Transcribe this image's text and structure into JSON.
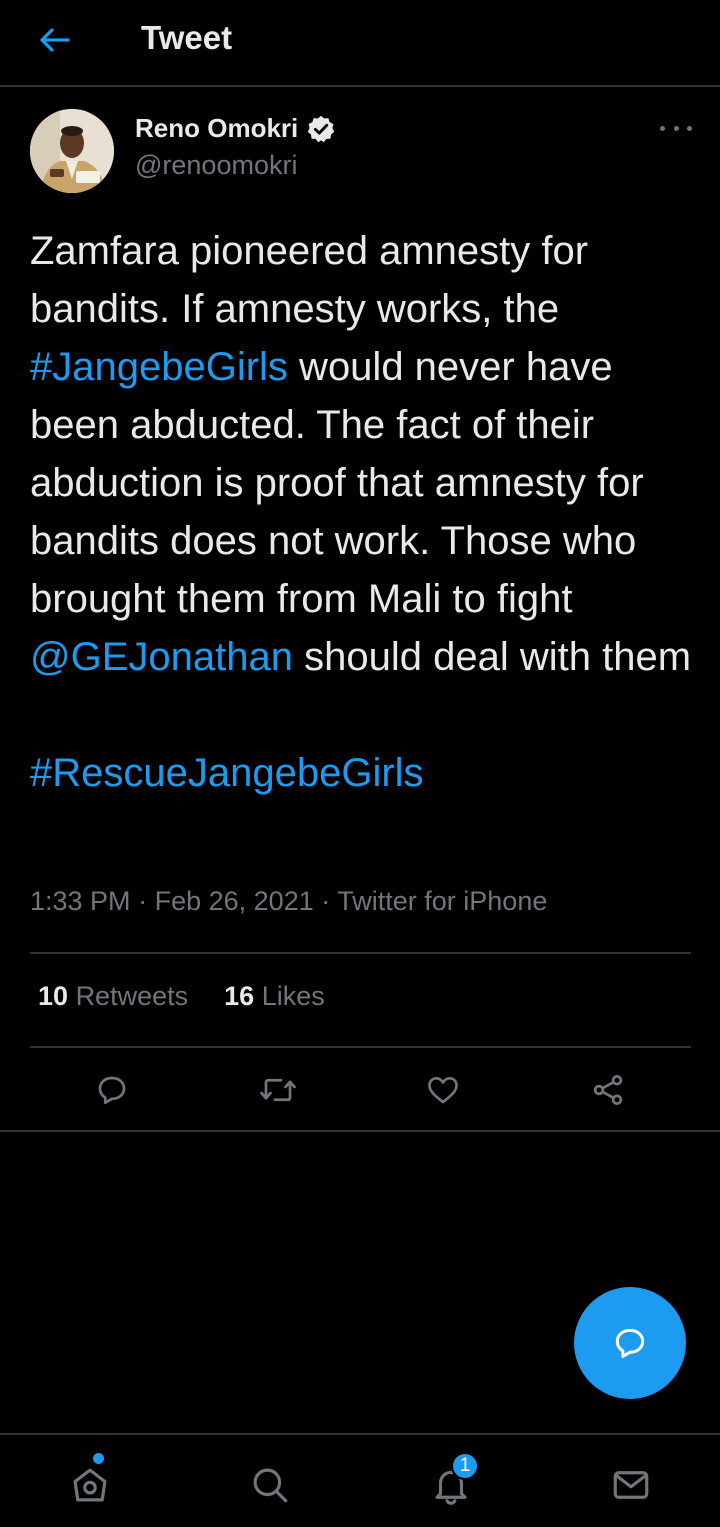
{
  "header": {
    "title": "Tweet"
  },
  "author": {
    "name": "Reno Omokri",
    "handle": "@renoomokri"
  },
  "tweet": {
    "line1": "Zamfara pioneered amnesty for bandits. If amnesty works, the ",
    "hashtag1": "#JangebeGirls",
    "line2": " would never have been abducted. The fact of their abduction is proof that amnesty for bandits does not work. Those who brought them from Mali to fight ",
    "mention": "@GEJonathan",
    "line3": " should deal with them",
    "hashtag2": "#RescueJangebeGirls"
  },
  "meta": {
    "time": "1:33 PM",
    "separator": "·",
    "date": "Feb 26, 2021",
    "source": "Twitter for iPhone"
  },
  "stats": {
    "retweets_count": "10",
    "retweets_label": "Retweets",
    "likes_count": "16",
    "likes_label": "Likes"
  },
  "nav": {
    "notifications_badge": "1"
  },
  "colors": {
    "accent": "#1d9bf0",
    "background": "#000000",
    "secondary_text": "#71767b"
  }
}
